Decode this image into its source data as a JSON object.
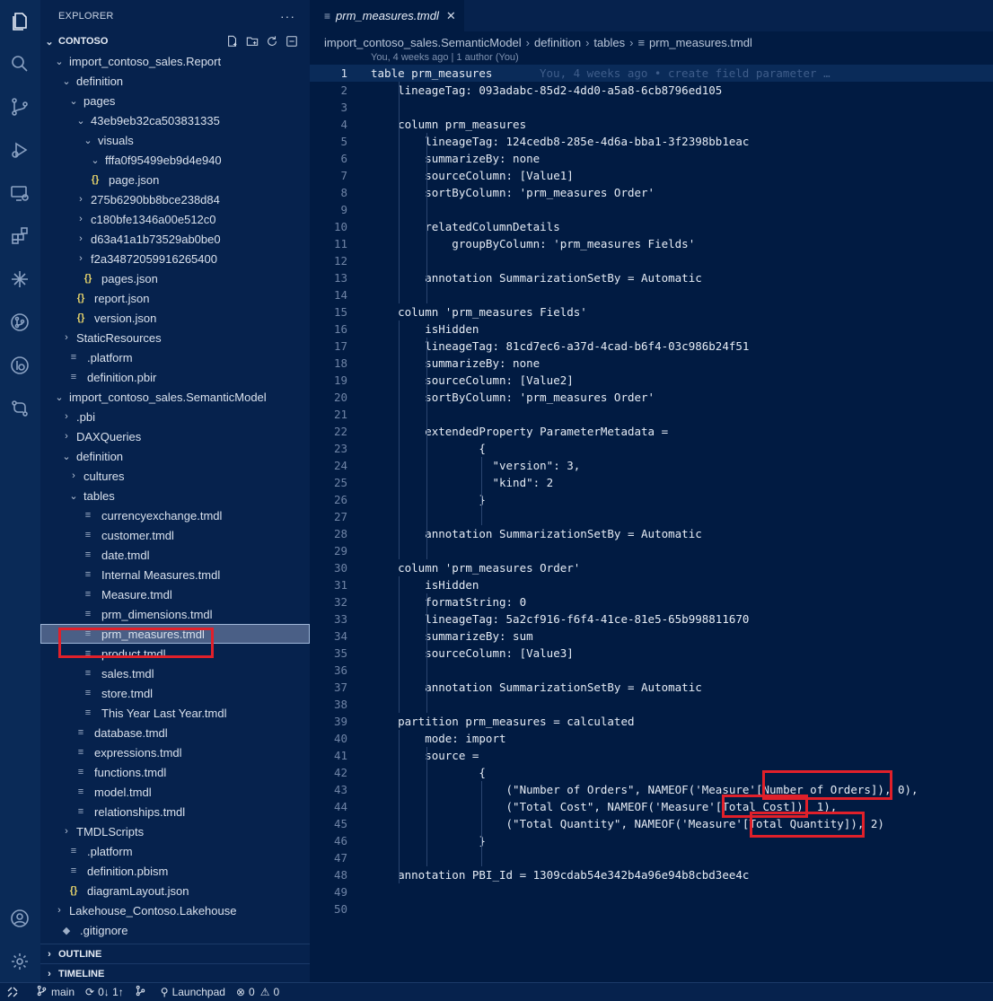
{
  "sidebar": {
    "title": "EXPLORER",
    "more_icon": "ellipsis-icon",
    "section": "CONTOSO",
    "tree": [
      {
        "label": "import_contoso_sales.Report",
        "twisty": "v",
        "icon": "",
        "depth": 0
      },
      {
        "label": "definition",
        "twisty": "v",
        "icon": "",
        "depth": 1
      },
      {
        "label": "pages",
        "twisty": "v",
        "icon": "",
        "depth": 2
      },
      {
        "label": "43eb9eb32ca503831335",
        "twisty": "v",
        "icon": "",
        "depth": 3
      },
      {
        "label": "visuals",
        "twisty": "v",
        "icon": "",
        "depth": 4
      },
      {
        "label": "fffa0f95499eb9d4e940",
        "twisty": "v",
        "icon": "",
        "depth": 5
      },
      {
        "label": "page.json",
        "twisty": "",
        "icon": "{}",
        "depth": 4
      },
      {
        "label": "275b6290bb8bce238d84",
        "twisty": ">",
        "icon": "",
        "depth": 3
      },
      {
        "label": "c180bfe1346a00e512c0",
        "twisty": ">",
        "icon": "",
        "depth": 3
      },
      {
        "label": "d63a41a1b73529ab0be0",
        "twisty": ">",
        "icon": "",
        "depth": 3
      },
      {
        "label": "f2a34872059916265400",
        "twisty": ">",
        "icon": "",
        "depth": 3
      },
      {
        "label": "pages.json",
        "twisty": "",
        "icon": "{}",
        "depth": 3
      },
      {
        "label": "report.json",
        "twisty": "",
        "icon": "{}",
        "depth": 2
      },
      {
        "label": "version.json",
        "twisty": "",
        "icon": "{}",
        "depth": 2
      },
      {
        "label": "StaticResources",
        "twisty": ">",
        "icon": "",
        "depth": 1
      },
      {
        "label": ".platform",
        "twisty": "",
        "icon": "≡",
        "depth": 1
      },
      {
        "label": "definition.pbir",
        "twisty": "",
        "icon": "≡",
        "depth": 1
      },
      {
        "label": "import_contoso_sales.SemanticModel",
        "twisty": "v",
        "icon": "",
        "depth": 0
      },
      {
        "label": ".pbi",
        "twisty": ">",
        "icon": "",
        "depth": 1
      },
      {
        "label": "DAXQueries",
        "twisty": ">",
        "icon": "",
        "depth": 1
      },
      {
        "label": "definition",
        "twisty": "v",
        "icon": "",
        "depth": 1
      },
      {
        "label": "cultures",
        "twisty": ">",
        "icon": "",
        "depth": 2
      },
      {
        "label": "tables",
        "twisty": "v",
        "icon": "",
        "depth": 2
      },
      {
        "label": "currencyexchange.tmdl",
        "twisty": "",
        "icon": "≡",
        "depth": 3
      },
      {
        "label": "customer.tmdl",
        "twisty": "",
        "icon": "≡",
        "depth": 3
      },
      {
        "label": "date.tmdl",
        "twisty": "",
        "icon": "≡",
        "depth": 3
      },
      {
        "label": "Internal Measures.tmdl",
        "twisty": "",
        "icon": "≡",
        "depth": 3
      },
      {
        "label": "Measure.tmdl",
        "twisty": "",
        "icon": "≡",
        "depth": 3
      },
      {
        "label": "prm_dimensions.tmdl",
        "twisty": "",
        "icon": "≡",
        "depth": 3
      },
      {
        "label": "prm_measures.tmdl",
        "twisty": "",
        "icon": "≡",
        "depth": 3,
        "selected": true
      },
      {
        "label": "product.tmdl",
        "twisty": "",
        "icon": "≡",
        "depth": 3
      },
      {
        "label": "sales.tmdl",
        "twisty": "",
        "icon": "≡",
        "depth": 3
      },
      {
        "label": "store.tmdl",
        "twisty": "",
        "icon": "≡",
        "depth": 3
      },
      {
        "label": "This Year Last Year.tmdl",
        "twisty": "",
        "icon": "≡",
        "depth": 3
      },
      {
        "label": "database.tmdl",
        "twisty": "",
        "icon": "≡",
        "depth": 2
      },
      {
        "label": "expressions.tmdl",
        "twisty": "",
        "icon": "≡",
        "depth": 2
      },
      {
        "label": "functions.tmdl",
        "twisty": "",
        "icon": "≡",
        "depth": 2
      },
      {
        "label": "model.tmdl",
        "twisty": "",
        "icon": "≡",
        "depth": 2
      },
      {
        "label": "relationships.tmdl",
        "twisty": "",
        "icon": "≡",
        "depth": 2
      },
      {
        "label": "TMDLScripts",
        "twisty": ">",
        "icon": "",
        "depth": 1
      },
      {
        "label": ".platform",
        "twisty": "",
        "icon": "≡",
        "depth": 1
      },
      {
        "label": "definition.pbism",
        "twisty": "",
        "icon": "≡",
        "depth": 1
      },
      {
        "label": "diagramLayout.json",
        "twisty": "",
        "icon": "{}",
        "depth": 1
      },
      {
        "label": "Lakehouse_Contoso.Lakehouse",
        "twisty": ">",
        "icon": "",
        "depth": 0
      },
      {
        "label": ".gitignore",
        "twisty": "",
        "icon": "◆",
        "depth": 0
      }
    ],
    "outline": "OUTLINE",
    "timeline": "TIMELINE"
  },
  "editor": {
    "tab": "prm_measures.tmdl",
    "breadcrumbs": [
      "import_contoso_sales.SemanticModel",
      "definition",
      "tables",
      "prm_measures.tmdl"
    ],
    "codelens": "You, 4 weeks ago | 1 author (You)",
    "blame": "You, 4 weeks ago • create field parameter …",
    "lines": [
      "table prm_measures",
      "    lineageTag: 093adabc-85d2-4dd0-a5a8-6cb8796ed105",
      "",
      "    column prm_measures",
      "        lineageTag: 124cedb8-285e-4d6a-bba1-3f2398bb1eac",
      "        summarizeBy: none",
      "        sourceColumn: [Value1]",
      "        sortByColumn: 'prm_measures Order'",
      "",
      "        relatedColumnDetails",
      "            groupByColumn: 'prm_measures Fields'",
      "",
      "        annotation SummarizationSetBy = Automatic",
      "",
      "    column 'prm_measures Fields'",
      "        isHidden",
      "        lineageTag: 81cd7ec6-a37d-4cad-b6f4-03c986b24f51",
      "        summarizeBy: none",
      "        sourceColumn: [Value2]",
      "        sortByColumn: 'prm_measures Order'",
      "",
      "        extendedProperty ParameterMetadata =",
      "                {",
      "                  \"version\": 3,",
      "                  \"kind\": 2",
      "                }",
      "",
      "        annotation SummarizationSetBy = Automatic",
      "",
      "    column 'prm_measures Order'",
      "        isHidden",
      "        formatString: 0",
      "        lineageTag: 5a2cf916-f6f4-41ce-81e5-65b998811670",
      "        summarizeBy: sum",
      "        sourceColumn: [Value3]",
      "",
      "        annotation SummarizationSetBy = Automatic",
      "",
      "    partition prm_measures = calculated",
      "        mode: import",
      "        source =",
      "                {",
      "                    (\"Number of Orders\", NAMEOF('Measure'[Number of Orders]), 0),",
      "                    (\"Total Cost\", NAMEOF('Measure'[Total Cost]), 1),",
      "                    (\"Total Quantity\", NAMEOF('Measure'[Total Quantity]), 2)",
      "                }",
      "",
      "    annotation PBI_Id = 1309cdab54e342b4a96e94b8cbd3ee4c",
      "",
      ""
    ]
  },
  "status": {
    "branch": "main",
    "sync": "0↓ 1↑",
    "launchpad": "Launchpad",
    "errors": "0",
    "warnings": "0"
  },
  "colors": {
    "highlight_box": "#e0202a",
    "selection": "#4a5f86"
  }
}
